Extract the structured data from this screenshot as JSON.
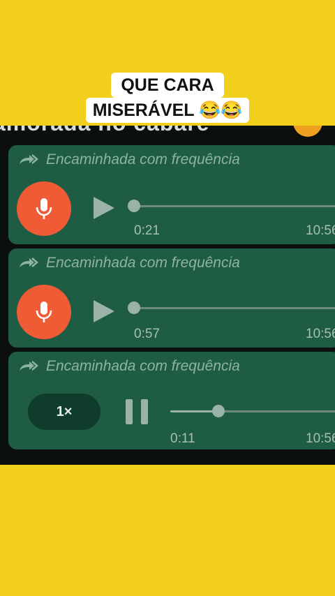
{
  "caption": {
    "line1": "QUE CARA",
    "line2": "MISERÁVEL 😂😂"
  },
  "header_cut_text": "amorada no cabaré",
  "messages": [
    {
      "forward_label": "Encaminhada com frequência",
      "duration": "0:21",
      "time": "10:56",
      "state": "unplayed",
      "progress": 0
    },
    {
      "forward_label": "Encaminhada com frequência",
      "duration": "0:57",
      "time": "10:56",
      "state": "unplayed",
      "progress": 0
    },
    {
      "forward_label": "Encaminhada com frequência",
      "duration": "0:11",
      "time": "10:56",
      "state": "playing",
      "progress": 0.28,
      "speed": "1×"
    }
  ],
  "icons": {
    "forward": "forward-double-arrow-icon",
    "mic": "microphone-icon",
    "play": "play-icon",
    "pause": "pause-icon"
  },
  "colors": {
    "background": "#f2cf1a",
    "bubble": "#1f5c44",
    "mic_button": "#ef5b34",
    "muted_text": "#8fb3a3"
  }
}
